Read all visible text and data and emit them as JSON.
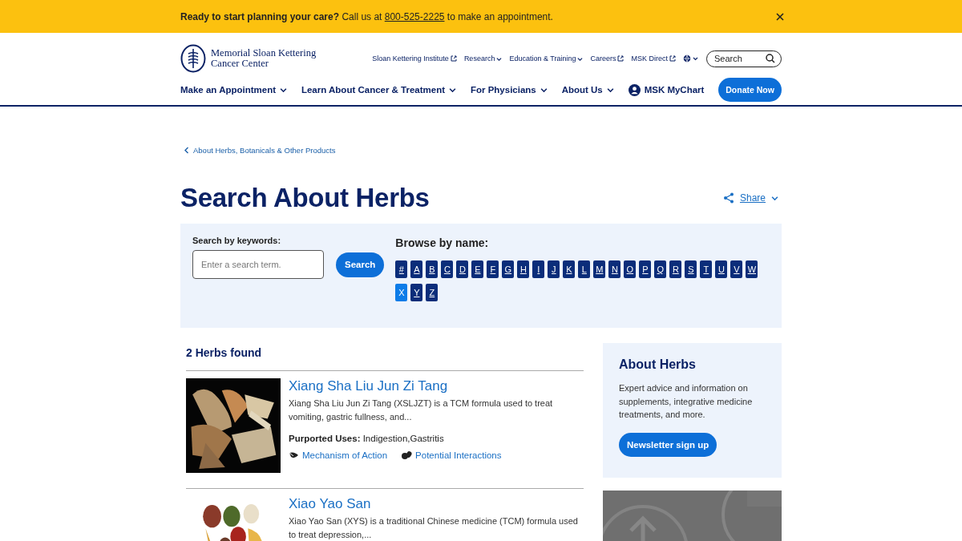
{
  "banner": {
    "lead": "Ready to start planning your care?",
    "before": "Call us at",
    "phone": "800-525-2225",
    "after": "to make an appointment."
  },
  "logo": {
    "line1": "Memorial Sloan Kettering",
    "line2": "Cancer Center"
  },
  "utility_links": [
    {
      "label": "Sloan Kettering Institute",
      "external": true,
      "dropdown": false
    },
    {
      "label": "Research",
      "external": false,
      "dropdown": true
    },
    {
      "label": "Education & Training",
      "external": false,
      "dropdown": true
    },
    {
      "label": "Careers",
      "external": true,
      "dropdown": false
    },
    {
      "label": "MSK Direct",
      "external": true,
      "dropdown": false
    }
  ],
  "site_search": {
    "placeholder": "Search"
  },
  "nav": [
    {
      "label": "Make an Appointment",
      "kind": "menu"
    },
    {
      "label": "Learn About Cancer & Treatment",
      "kind": "menu"
    },
    {
      "label": "For Physicians",
      "kind": "menu"
    },
    {
      "label": "About Us",
      "kind": "menu"
    },
    {
      "label": "MSK MyChart",
      "kind": "account"
    }
  ],
  "donate": "Donate Now",
  "breadcrumb": "About Herbs, Botanicals & Other Products",
  "title": "Search About Herbs",
  "share": "Share",
  "search": {
    "label": "Search by keywords:",
    "placeholder": "Enter a search term.",
    "button": "Search"
  },
  "browse": {
    "label": "Browse by name:",
    "letters": [
      {
        "label": "#",
        "selected": false
      },
      {
        "label": "A",
        "selected": false
      },
      {
        "label": "B",
        "selected": false
      },
      {
        "label": "C",
        "selected": false
      },
      {
        "label": "D",
        "selected": false
      },
      {
        "label": "E",
        "selected": false
      },
      {
        "label": "F",
        "selected": false
      },
      {
        "label": "G",
        "selected": false
      },
      {
        "label": "H",
        "selected": false
      },
      {
        "label": "I",
        "selected": false
      },
      {
        "label": "J",
        "selected": false
      },
      {
        "label": "K",
        "selected": false
      },
      {
        "label": "L",
        "selected": false
      },
      {
        "label": "M",
        "selected": false
      },
      {
        "label": "N",
        "selected": false
      },
      {
        "label": "O",
        "selected": false
      },
      {
        "label": "P",
        "selected": false
      },
      {
        "label": "Q",
        "selected": false
      },
      {
        "label": "R",
        "selected": false
      },
      {
        "label": "S",
        "selected": false
      },
      {
        "label": "T",
        "selected": false
      },
      {
        "label": "U",
        "selected": false
      },
      {
        "label": "V",
        "selected": false
      },
      {
        "label": "W",
        "selected": false
      },
      {
        "label": "X",
        "selected": true
      },
      {
        "label": "Y",
        "selected": false
      },
      {
        "label": "Z",
        "selected": false
      }
    ]
  },
  "results": {
    "count": "2 Herbs found",
    "herbs": [
      {
        "title": "Xiang Sha Liu Jun Zi Tang",
        "description": "Xiang Sha Liu Jun Zi Tang (XSLJZT) is a TCM formula used to treat vomiting, gastric fullness, and...",
        "uses_label": "Purported Uses:",
        "uses": "Indigestion,Gastritis",
        "links": [
          {
            "label": "Mechanism of Action",
            "kind": "mechanism"
          },
          {
            "label": "Potential Interactions",
            "kind": "interactions"
          }
        ]
      },
      {
        "title": "Xiao Yao San",
        "description": "Xiao Yao San (XYS) is a traditional Chinese medicine (TCM) formula used to treat depression,..."
      }
    ]
  },
  "aside": {
    "title": "About Herbs",
    "text": "Expert advice and information on supplements, integrative medicine treatments, and more.",
    "button": "Newsletter sign up"
  }
}
